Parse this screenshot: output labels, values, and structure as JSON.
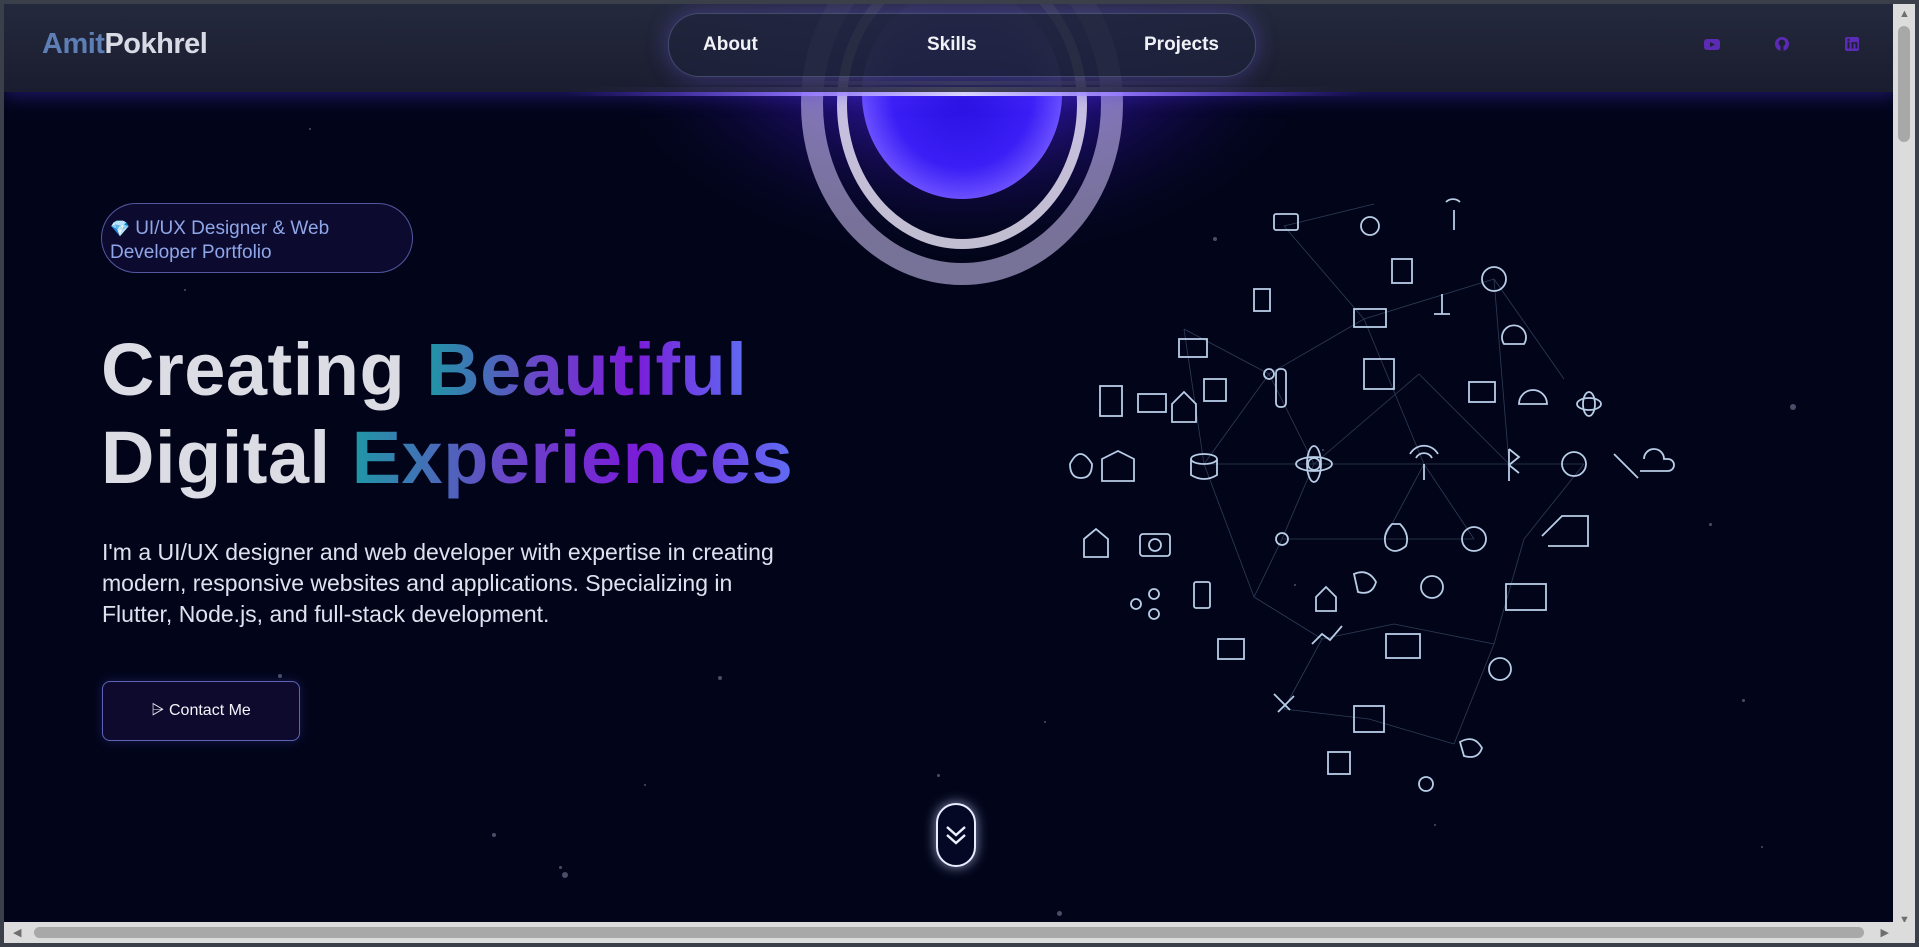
{
  "logo": {
    "first": "Amit",
    "last": "Pokhrel"
  },
  "nav": {
    "items": [
      {
        "label": "About"
      },
      {
        "label": "Skills"
      },
      {
        "label": "Projects"
      }
    ]
  },
  "social": [
    {
      "icon": "youtube-icon"
    },
    {
      "icon": "github-icon"
    },
    {
      "icon": "linkedin-icon"
    }
  ],
  "hero": {
    "badge_icon": "💎",
    "badge_text": "UI/UX Designer & Web Developer Portfolio",
    "headline_line1_plain": "Creating ",
    "headline_line1_accent": "Beautiful",
    "headline_line2_plain": "Digital ",
    "headline_line2_accent": "Experiences",
    "description": "I'm a UI/UX designer and web developer with expertise in creating modern, responsive websites and applications. Specializing in Flutter, Node.js, and full-stack development.",
    "contact_icon": "⩥",
    "contact_label": "Contact Me"
  },
  "colors": {
    "accent_gradient_start": "#1f97a6",
    "accent_gradient_mid": "#7a1cd8",
    "accent_gradient_end": "#5f6cf3",
    "social_icon": "#5b2bb5",
    "background": "#02051a"
  }
}
